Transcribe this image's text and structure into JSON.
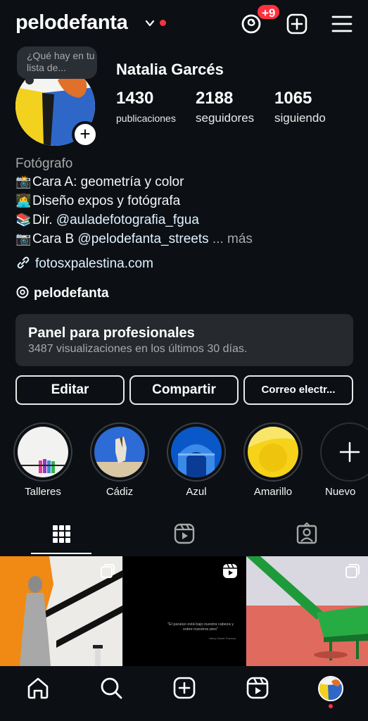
{
  "header": {
    "username": "pelodefanta",
    "threads_badge": "+9",
    "icons": [
      "chevron-down-icon",
      "threads-icon",
      "create-icon",
      "menu-icon"
    ]
  },
  "profile": {
    "note": "¿Qué hay en tu lista de...",
    "full_name": "Natalia Garcés",
    "stats": [
      {
        "value": "1430",
        "label": "publicaciones"
      },
      {
        "value": "2188",
        "label": "seguidores"
      },
      {
        "value": "1065",
        "label": "siguiendo"
      }
    ]
  },
  "bio": {
    "category": "Fotógrafo",
    "line1": "Cara A: geometría y color",
    "line2": "Diseño expos y fotógrafa",
    "line3_prefix": "Dir. ",
    "line3_mention": "@auladefotografia_fgua",
    "line4_prefix": "Cara B ",
    "line4_mention": "@pelodefanta_streets",
    "more": "... más",
    "website": "fotosxpalestina.com",
    "threads_handle": "pelodefanta"
  },
  "dashboard": {
    "title": "Panel para profesionales",
    "subtitle": "3487 visualizaciones en los últimos 30 días."
  },
  "buttons": {
    "edit": "Editar",
    "share": "Compartir",
    "email": "Correo electr..."
  },
  "highlights": [
    {
      "label": "Talleres"
    },
    {
      "label": "Cádiz"
    },
    {
      "label": "Azul"
    },
    {
      "label": "Amarillo"
    },
    {
      "label": "Nuevo"
    }
  ],
  "grid": {
    "quote_text": "\"El paraíso está bajo nuestra cabeza y sobre nuestros pies\"",
    "quote_author": "Henry David Thoreau"
  },
  "colors": {
    "background": "#0c1014",
    "accent_red": "#ff3040",
    "link": "#e0f1ff",
    "panel": "#262a2f"
  }
}
